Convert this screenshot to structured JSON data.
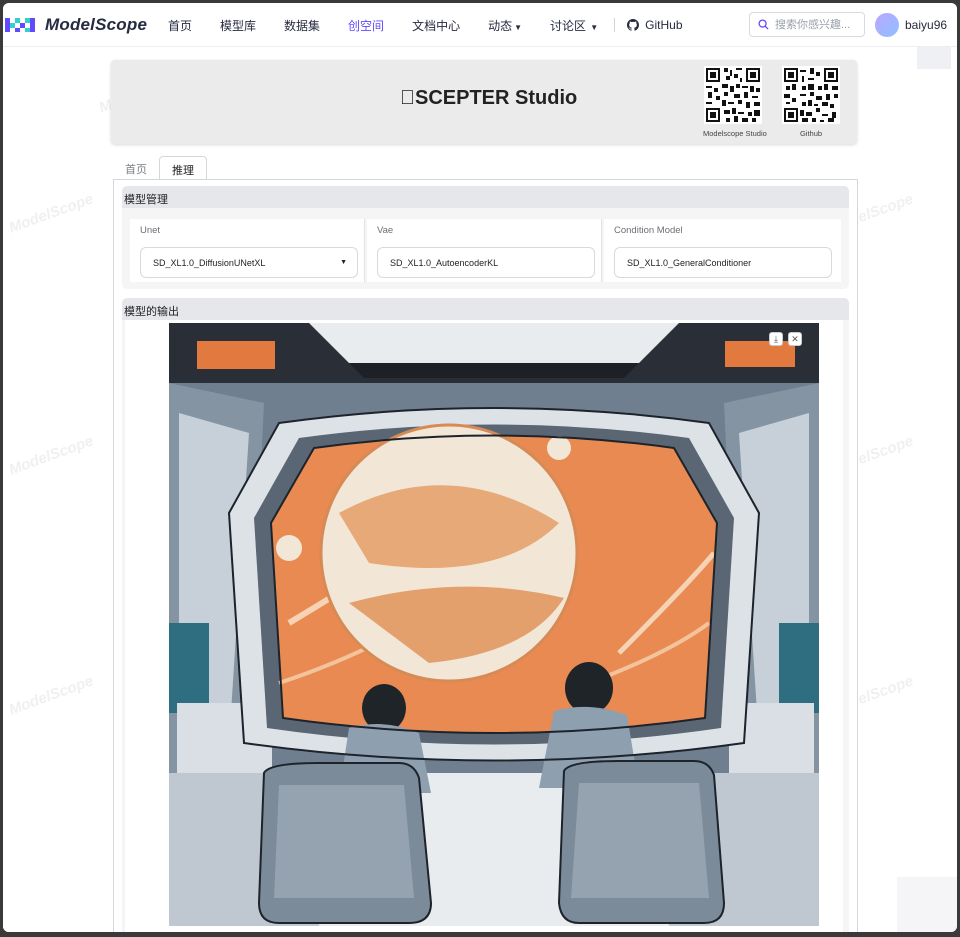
{
  "nav": {
    "logo_text": "ModelScope",
    "links": [
      "首页",
      "模型库",
      "数据集",
      "创空间",
      "文档中心",
      "动态",
      "讨论区"
    ],
    "github_label": "GitHub",
    "search_placeholder": "搜索你感兴趣...",
    "username": "baiyu96",
    "accent_color": "#624aff"
  },
  "header": {
    "title": "SCEPTER Studio",
    "qr_codes": [
      {
        "label": "Modelscope Studio"
      },
      {
        "label": "Github"
      }
    ]
  },
  "tabs": [
    {
      "label": "首页",
      "active": false
    },
    {
      "label": "推理",
      "active": true
    }
  ],
  "model_management": {
    "title": "模型管理",
    "fields": [
      {
        "label": "Unet",
        "value": "SD_XL1.0_DiffusionUNetXL",
        "dropdown": true
      },
      {
        "label": "Vae",
        "value": "SD_XL1.0_AutoencoderKL",
        "dropdown": false
      },
      {
        "label": "Condition Model",
        "value": "SD_XL1.0_GeneralConditioner",
        "dropdown": false
      }
    ]
  },
  "output": {
    "title": "模型的输出",
    "download_icon": "download-icon",
    "close_icon": "close-icon"
  },
  "watermark_text": "ModelScope"
}
